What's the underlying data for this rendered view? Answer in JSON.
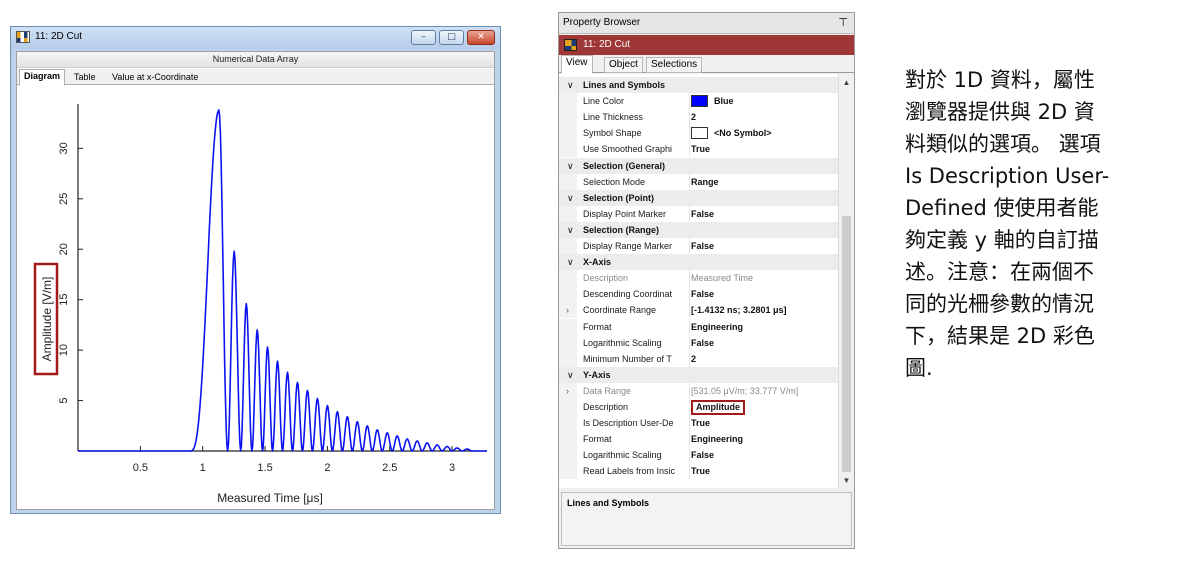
{
  "window": {
    "title": "11: 2D Cut",
    "header": "Numerical Data Array",
    "tabs": [
      "Diagram",
      "Table",
      "Value at x-Coordinate"
    ],
    "active_tab": "Diagram",
    "caption_buttons": {
      "minimize": "–",
      "maximize": "□",
      "close": "✕"
    }
  },
  "chart_data": {
    "type": "line",
    "xlabel": "Measured Time [μs]",
    "ylabel": "Amplitude [V/m]",
    "xlim": [
      0,
      3.28
    ],
    "ylim": [
      0,
      34
    ],
    "x_ticks": [
      0.5,
      1,
      1.5,
      2,
      2.5,
      3
    ],
    "x_tick_labels": [
      "0.5",
      "1",
      "1.5",
      "2",
      "2.5",
      "3"
    ],
    "y_ticks": [
      5,
      10,
      15,
      20,
      25,
      30
    ],
    "y_tick_labels": [
      "5",
      "10",
      "15",
      "20",
      "25",
      "30"
    ],
    "grid": false,
    "series": [
      {
        "color": "#0b14f0",
        "pulse_peaks": [
          {
            "t": 1.13,
            "amp": 33.8
          },
          {
            "t": 1.26,
            "amp": 19.8
          },
          {
            "t": 1.35,
            "amp": 14.6
          },
          {
            "t": 1.44,
            "amp": 12.0
          },
          {
            "t": 1.52,
            "amp": 10.3
          },
          {
            "t": 1.6,
            "amp": 8.9
          },
          {
            "t": 1.68,
            "amp": 7.8
          },
          {
            "t": 1.76,
            "amp": 6.8
          },
          {
            "t": 1.84,
            "amp": 6.0
          },
          {
            "t": 1.92,
            "amp": 5.2
          },
          {
            "t": 2.0,
            "amp": 4.5
          },
          {
            "t": 2.08,
            "amp": 3.9
          },
          {
            "t": 2.16,
            "amp": 3.4
          },
          {
            "t": 2.24,
            "amp": 2.9
          },
          {
            "t": 2.32,
            "amp": 2.5
          },
          {
            "t": 2.4,
            "amp": 2.1
          },
          {
            "t": 2.48,
            "amp": 1.8
          },
          {
            "t": 2.56,
            "amp": 1.5
          },
          {
            "t": 2.64,
            "amp": 1.2
          },
          {
            "t": 2.72,
            "amp": 1.0
          },
          {
            "t": 2.8,
            "amp": 0.8
          },
          {
            "t": 2.88,
            "amp": 0.6
          },
          {
            "t": 2.96,
            "amp": 0.45
          },
          {
            "t": 3.04,
            "amp": 0.3
          },
          {
            "t": 3.12,
            "amp": 0.2
          }
        ],
        "rise_start": 0.9,
        "first_min": 1.2,
        "baseline": 0.0
      }
    ]
  },
  "property_browser": {
    "title": "Property Browser",
    "pin_icon": "pin-icon",
    "object": "11: 2D Cut",
    "tabs": [
      "View",
      "Object",
      "Selections"
    ],
    "active_tab": "View",
    "rows": [
      {
        "kind": "cat",
        "label": "Lines and Symbols"
      },
      {
        "kind": "prop",
        "name": "Line Color",
        "value": "Blue",
        "swatch": "#0000ff"
      },
      {
        "kind": "prop",
        "name": "Line Thickness",
        "value": "2"
      },
      {
        "kind": "prop",
        "name": "Symbol Shape",
        "value": "<No Symbol>",
        "swatch": "#ffffff"
      },
      {
        "kind": "prop",
        "name": "Use Smoothed Graphi",
        "value": "True"
      },
      {
        "kind": "cat",
        "label": "Selection (General)"
      },
      {
        "kind": "prop",
        "name": "Selection Mode",
        "value": "Range"
      },
      {
        "kind": "cat",
        "label": "Selection (Point)"
      },
      {
        "kind": "prop",
        "name": "Display Point Marker",
        "value": "False"
      },
      {
        "kind": "cat",
        "label": "Selection (Range)"
      },
      {
        "kind": "prop",
        "name": "Display Range Marker",
        "value": "False"
      },
      {
        "kind": "cat",
        "label": "X-Axis"
      },
      {
        "kind": "prop",
        "name": "Description",
        "value": "Measured Time",
        "dim": true
      },
      {
        "kind": "prop",
        "name": "Descending Coordinat",
        "value": "False"
      },
      {
        "kind": "prop",
        "name": "Coordinate Range",
        "value": "[-1.4132 ns; 3.2801 μs]",
        "expand": true
      },
      {
        "kind": "prop",
        "name": "Format",
        "value": "Engineering"
      },
      {
        "kind": "prop",
        "name": "Logarithmic Scaling",
        "value": "False"
      },
      {
        "kind": "prop",
        "name": "Minimum Number of T",
        "value": "2"
      },
      {
        "kind": "cat",
        "label": "Y-Axis"
      },
      {
        "kind": "prop",
        "name": "Data Range",
        "value": "[531.05 μV/m; 33.777 V/m]",
        "dim": true,
        "expand": true
      },
      {
        "kind": "prop",
        "name": "Description",
        "value": "Amplitude",
        "highlight": true
      },
      {
        "kind": "prop",
        "name": "Is Description User-De",
        "value": "True"
      },
      {
        "kind": "prop",
        "name": "Format",
        "value": "Engineering"
      },
      {
        "kind": "prop",
        "name": "Logarithmic Scaling",
        "value": "False"
      },
      {
        "kind": "prop",
        "name": "Read Labels from Insic",
        "value": "True"
      }
    ],
    "description_pane": "Lines and Symbols"
  },
  "note_lines": [
    "對於 1D 資料，屬性",
    "瀏覽器提供與 2D 資",
    "料類似的選項。 選項",
    "Is Description User-",
    "Defined 使使用者能",
    "夠定義 y 軸的自訂描",
    "述。注意：在兩個不",
    "同的光柵參數的情況",
    "下，結果是 2D 彩色",
    "圖."
  ]
}
